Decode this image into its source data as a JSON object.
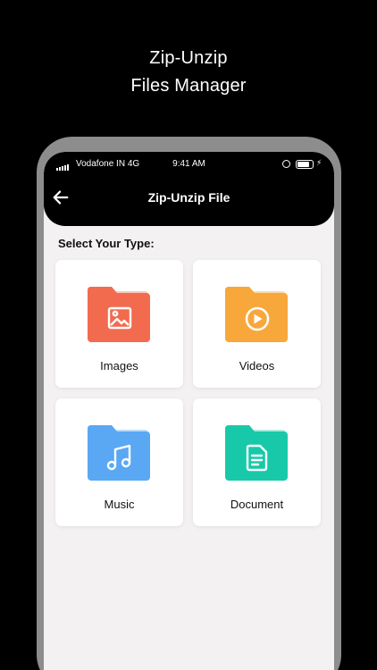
{
  "promo": {
    "line1": "Zip-Unzip",
    "line2": "Files Manager"
  },
  "status_bar": {
    "carrier": "Vodafone IN 4G",
    "time": "9:41 AM",
    "bolt": "⚡"
  },
  "header": {
    "title": "Zip-Unzip File"
  },
  "section_title": "Select Your Type:",
  "types": [
    {
      "label": "Images",
      "color": "#f26b4f",
      "tab": "#f9c6b8",
      "icon": "image-icon"
    },
    {
      "label": "Videos",
      "color": "#f8a73b",
      "tab": "#fcd9a9",
      "icon": "play-icon"
    },
    {
      "label": "Music",
      "color": "#5aa8f3",
      "tab": "#bcdcfa",
      "icon": "music-note-icon"
    },
    {
      "label": "Document",
      "color": "#18c9a9",
      "tab": "#a8ecdf",
      "icon": "document-icon"
    }
  ]
}
